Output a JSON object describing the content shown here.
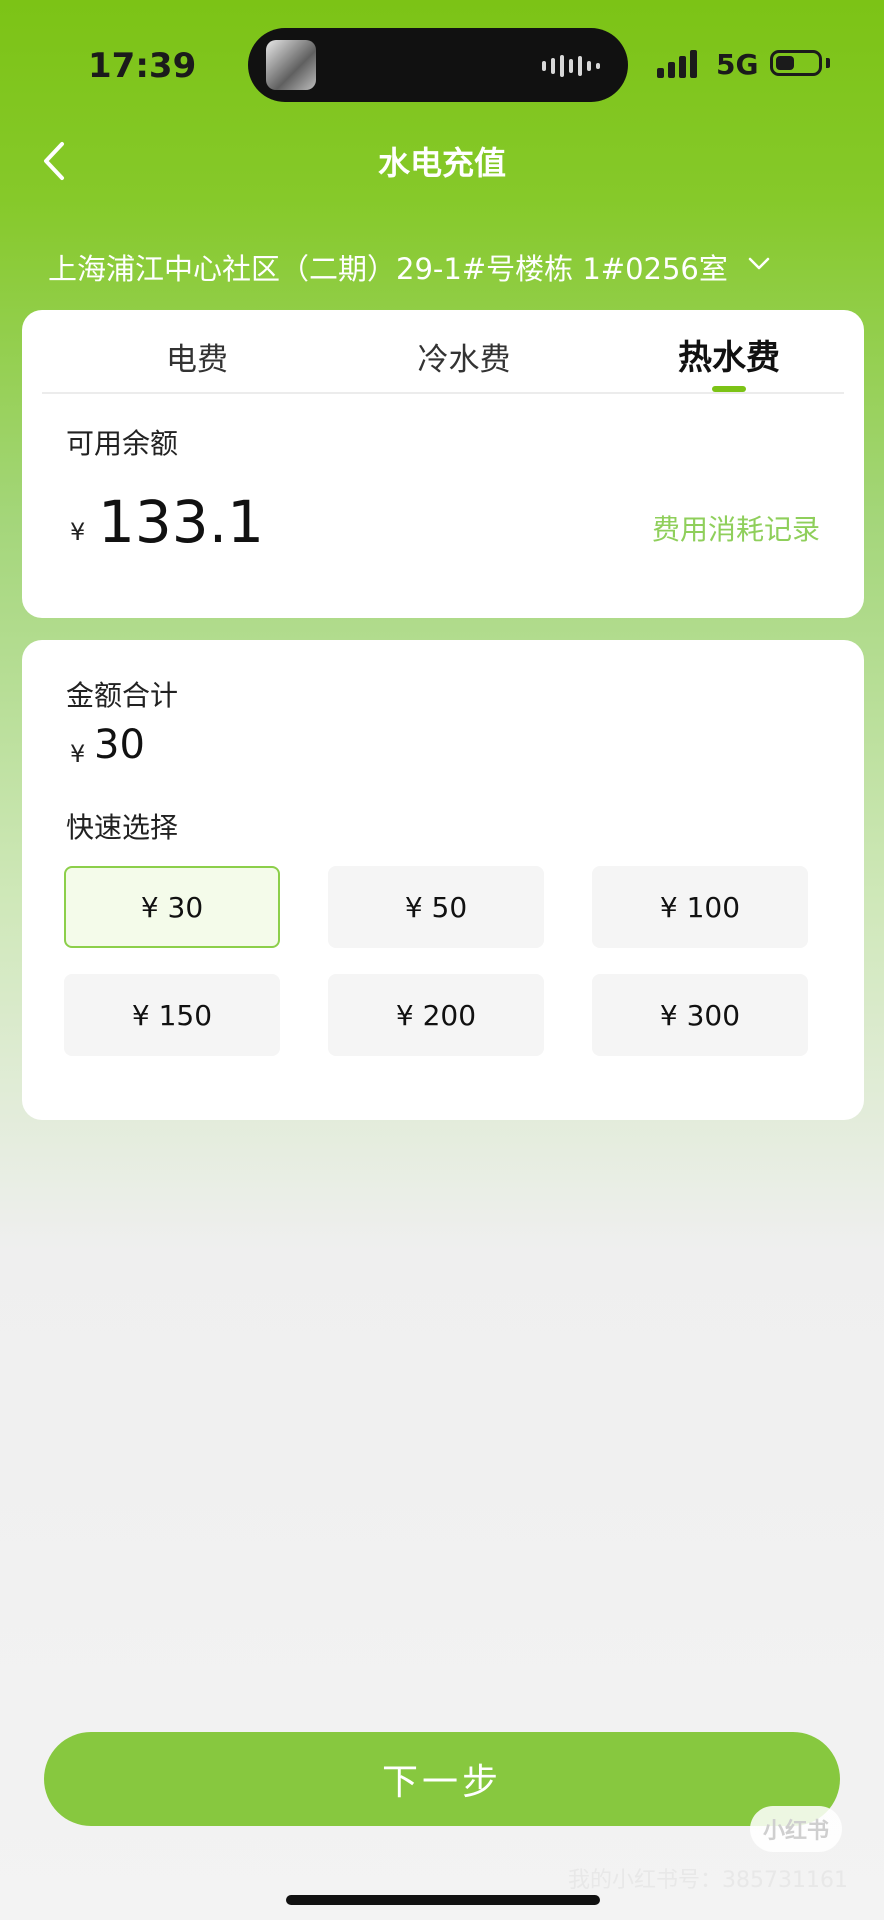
{
  "status_bar": {
    "time": "17:39",
    "network": "5G"
  },
  "nav": {
    "title": "水电充值"
  },
  "address": "上海浦江中心社区（二期）29-1#号楼栋 1#0256室",
  "tabs": [
    {
      "label": "电费",
      "active": false
    },
    {
      "label": "冷水费",
      "active": false
    },
    {
      "label": "热水费",
      "active": true
    }
  ],
  "balance": {
    "label": "可用余额",
    "currency": "¥",
    "value": "133.1",
    "records_link": "费用消耗记录"
  },
  "amount": {
    "total_label": "金额合计",
    "currency": "¥",
    "total_value": "30",
    "quick_label": "快速选择",
    "options": [
      "¥ 30",
      "¥ 50",
      "¥ 100",
      "¥ 150",
      "¥ 200",
      "¥ 300"
    ],
    "selected_index": 0
  },
  "next_button": "下一步",
  "watermark": {
    "logo": "小红书",
    "text": "我的小红书号：385731161"
  },
  "colors": {
    "brand_green": "#7cc316",
    "button_green": "#87c83f",
    "link_green": "#8fcf5b"
  }
}
